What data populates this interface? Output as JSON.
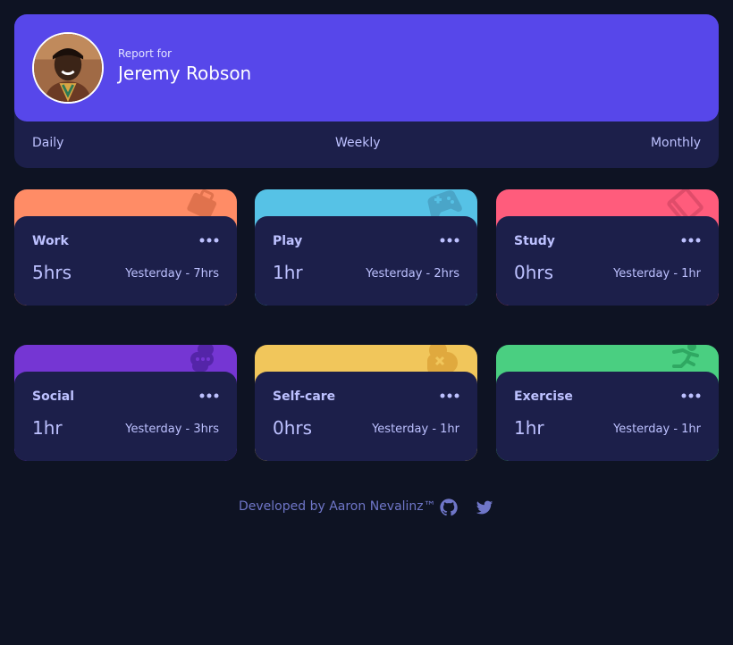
{
  "profile": {
    "report_label": "Report for",
    "name": "Jeremy Robson"
  },
  "tabs": [
    {
      "label": "Daily"
    },
    {
      "label": "Weekly"
    },
    {
      "label": "Monthly"
    }
  ],
  "cards": [
    {
      "title": "Work",
      "current": "5hrs",
      "previous": "Yesterday - 7hrs",
      "color": "#ff8c66",
      "icon": "briefcase-icon"
    },
    {
      "title": "Play",
      "current": "1hr",
      "previous": "Yesterday - 2hrs",
      "color": "#56c2e6",
      "icon": "gamepad-icon"
    },
    {
      "title": "Study",
      "current": "0hrs",
      "previous": "Yesterday - 1hr",
      "color": "#ff5c7c",
      "icon": "book-icon"
    },
    {
      "title": "Social",
      "current": "1hr",
      "previous": "Yesterday - 3hrs",
      "color": "#7536d3",
      "icon": "chat-icon"
    },
    {
      "title": "Self-care",
      "current": "0hrs",
      "previous": "Yesterday - 1hr",
      "color": "#f1c65b",
      "icon": "bandage-icon"
    },
    {
      "title": "Exercise",
      "current": "1hr",
      "previous": "Yesterday - 1hr",
      "color": "#4acf81",
      "icon": "running-icon"
    }
  ],
  "footer": {
    "credit": "Developed by Aaron Nevalinz™",
    "icons": [
      "github-icon",
      "twitter-icon"
    ]
  },
  "colors": {
    "background": "#0e1323",
    "card": "#1c1f4a",
    "accent": "#5747ea",
    "pale_blue": "#bdc1ff"
  }
}
